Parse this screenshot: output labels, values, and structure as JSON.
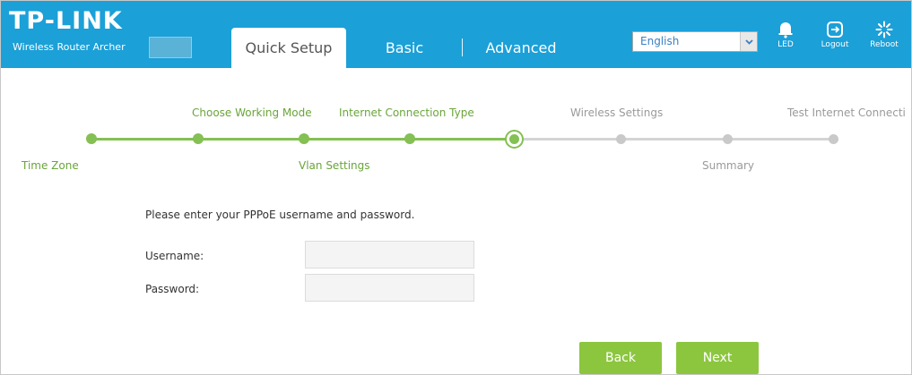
{
  "header": {
    "brand": "TP-LINK",
    "subtitle": "Wireless Router Archer",
    "tabs": [
      {
        "label": "Quick Setup",
        "active": true
      },
      {
        "label": "Basic",
        "active": false
      },
      {
        "label": "Advanced",
        "active": false
      }
    ],
    "language": {
      "selected": "English"
    },
    "buttons": {
      "led": "LED",
      "logout": "Logout",
      "reboot": "Reboot"
    },
    "colors": {
      "bar": "#1ba0d8",
      "accent_green": "#84c053"
    }
  },
  "progress": {
    "steps": [
      {
        "label": "Time Zone",
        "state": "done"
      },
      {
        "label": "Choose Working Mode",
        "state": "done"
      },
      {
        "label": "Vlan Settings",
        "state": "done"
      },
      {
        "label": "Internet Connection Type",
        "state": "done"
      },
      {
        "label": "",
        "state": "current"
      },
      {
        "label": "Wireless Settings",
        "state": "todo"
      },
      {
        "label": "Summary",
        "state": "todo"
      },
      {
        "label": "Test Internet Connecti",
        "state": "todo"
      }
    ]
  },
  "form": {
    "intro": "Please enter your PPPoE username and password.",
    "username_label": "Username:",
    "username_value": "",
    "password_label": "Password:",
    "password_value": ""
  },
  "actions": {
    "back": "Back",
    "next": "Next"
  }
}
